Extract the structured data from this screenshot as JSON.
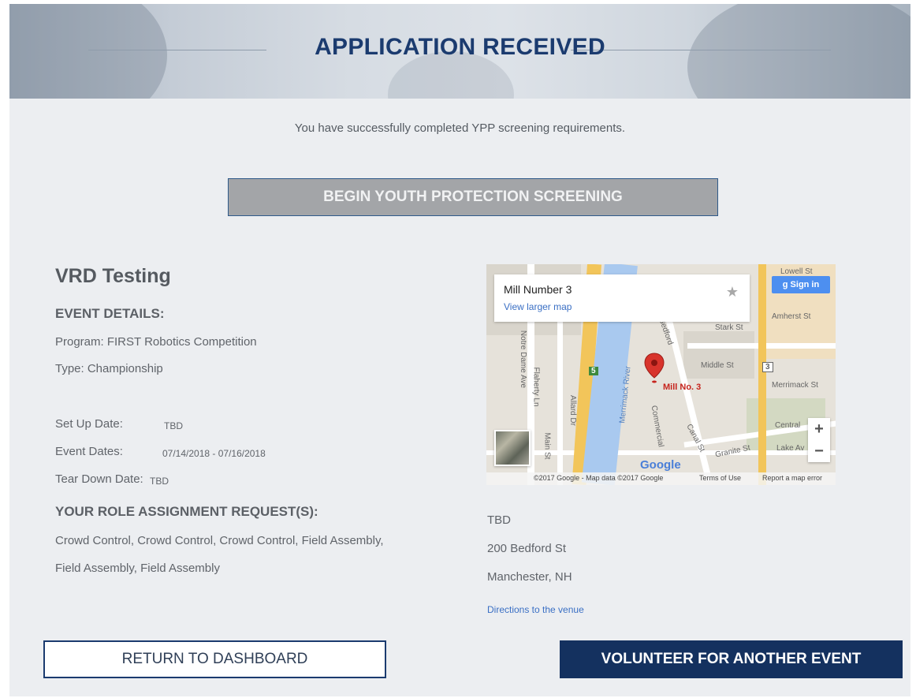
{
  "header": {
    "title": "APPLICATION RECEIVED"
  },
  "status": {
    "message": "You have successfully completed YPP screening requirements."
  },
  "actions": {
    "begin_screening": "BEGIN YOUTH PROTECTION SCREENING",
    "return_dashboard": "RETURN TO DASHBOARD",
    "volunteer_another": "VOLUNTEER FOR ANOTHER EVENT"
  },
  "event": {
    "name": "VRD Testing",
    "details_heading": "EVENT DETAILS:",
    "program": "Program: FIRST Robotics Competition",
    "type": "Type: Championship",
    "dates": [
      {
        "label": "Set Up Date:",
        "value": "TBD"
      },
      {
        "label": "Event Dates:",
        "value": "07/14/2018 - 07/16/2018"
      },
      {
        "label": "Tear Down Date:",
        "value": "TBD"
      }
    ],
    "roles_heading": "YOUR ROLE ASSIGNMENT REQUEST(S):",
    "roles_line1": "Crowd Control, Crowd Control, Crowd Control, Field Assembly,",
    "roles_line2": "Field Assembly, Field Assembly"
  },
  "map": {
    "place_name": "Mill Number 3",
    "larger_map_link": "View larger map",
    "sign_in": "Sign in",
    "pin_label": "Mill No. 3",
    "google_logo": "Google",
    "zoom_in": "+",
    "zoom_out": "−",
    "street_labels": {
      "stark": "Stark St",
      "amherst": "Amherst St",
      "middle": "Middle St",
      "merrimack_st": "Merrimack St",
      "central": "Central",
      "lake": "Lake Av",
      "granite": "Granite St",
      "canal": "Canal St",
      "commercial": "Commercial",
      "river": "Merrimack River",
      "notre_dame": "Notre Dame Ave",
      "flaherty": "Flaherty Ln",
      "allard": "Allard Dr",
      "main": "Main St",
      "bedford": "Bedford",
      "lowell": "Lowell St",
      "route_3": "3",
      "route_5": "5"
    },
    "footer": {
      "copyright": "©2017 Google - Map data ©2017 Google",
      "terms": "Terms of Use",
      "report": "Report a map error"
    },
    "colors": {
      "pin": "#c6241d",
      "water": "#a9c9ef",
      "highway": "#f2c55a"
    }
  },
  "venue": {
    "name": "TBD",
    "street": "200 Bedford St",
    "city": "Manchester, NH",
    "directions_link": "Directions to the venue"
  },
  "colors": {
    "navy": "#14315f",
    "title": "#1b3b6f",
    "panel": "#eceef1",
    "disabled_button": "#a3a5a8"
  }
}
